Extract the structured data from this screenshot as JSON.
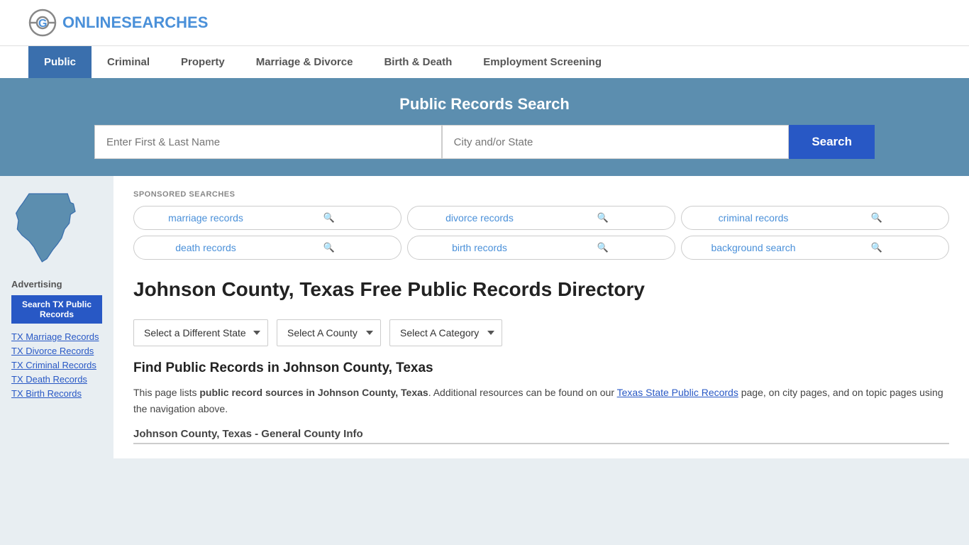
{
  "header": {
    "logo_text_plain": "ONLINE",
    "logo_text_highlight": "SEARCHES"
  },
  "nav": {
    "items": [
      {
        "label": "Public",
        "active": true
      },
      {
        "label": "Criminal",
        "active": false
      },
      {
        "label": "Property",
        "active": false
      },
      {
        "label": "Marriage & Divorce",
        "active": false
      },
      {
        "label": "Birth & Death",
        "active": false
      },
      {
        "label": "Employment Screening",
        "active": false
      }
    ]
  },
  "hero": {
    "title": "Public Records Search",
    "name_placeholder": "Enter First & Last Name",
    "location_placeholder": "City and/or State",
    "search_button": "Search"
  },
  "sponsored": {
    "label": "SPONSORED SEARCHES",
    "tags": [
      "marriage records",
      "divorce records",
      "criminal records",
      "death records",
      "birth records",
      "background search"
    ]
  },
  "page_heading": {
    "title": "Johnson County, Texas Free Public Records Directory"
  },
  "dropdowns": {
    "state_label": "Select a Different State",
    "county_label": "Select A County",
    "category_label": "Select A Category"
  },
  "find_section": {
    "heading": "Find Public Records in Johnson County, Texas",
    "text_before": "This page lists ",
    "bold1": "public record sources in Johnson County, Texas",
    "text_middle": ". Additional resources can be found on our ",
    "link_text": "Texas State Public Records",
    "text_after": " page, on city pages, and on topic pages using the navigation above."
  },
  "general_info": {
    "title": "Johnson County, Texas - General County Info"
  },
  "sidebar": {
    "advertising_label": "Advertising",
    "ad_banner": "Search TX Public Records",
    "links": [
      {
        "label": "TX Marriage Records"
      },
      {
        "label": "TX Divorce Records"
      },
      {
        "label": "TX Criminal Records"
      },
      {
        "label": "TX Death Records"
      },
      {
        "label": "TX Birth Records"
      }
    ]
  }
}
